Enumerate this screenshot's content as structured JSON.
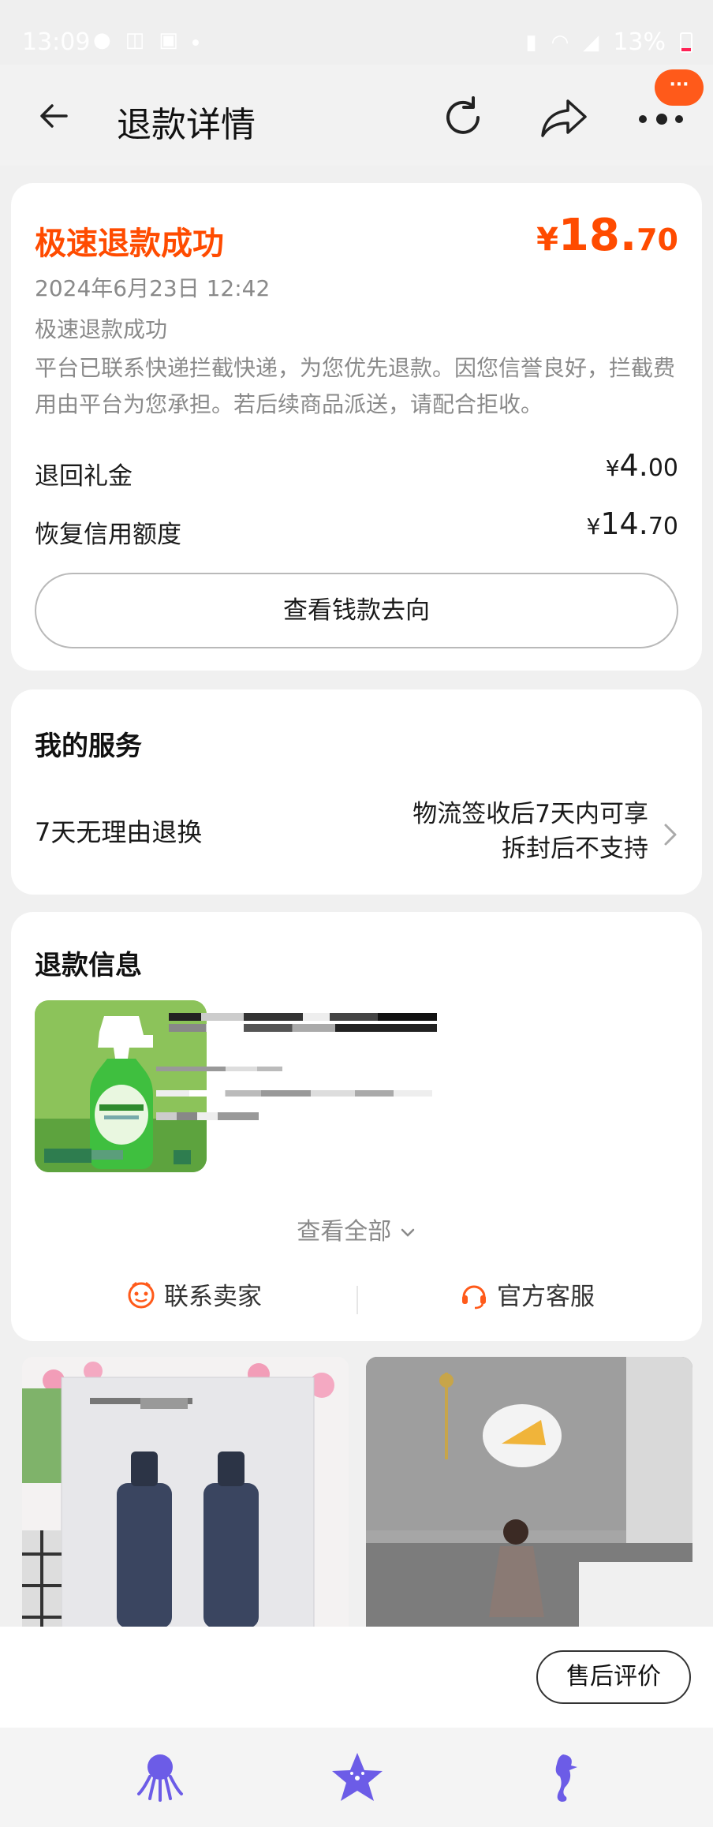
{
  "status_bar": {
    "time": "13:09",
    "battery": "13%",
    "icons_left": [
      "chat-icon",
      "notification-icon",
      "gallery-icon"
    ],
    "icons_right": [
      "sim-icon",
      "wifi-icon",
      "hd-icon",
      "signal-icon",
      "battery-icon"
    ]
  },
  "nav": {
    "title": "退款详情",
    "badge": "···",
    "icons": [
      "back-arrow-icon",
      "refresh-icon",
      "share-icon",
      "more-icon"
    ]
  },
  "refund": {
    "title": "极速退款成功",
    "amount_symbol": "¥",
    "amount_int": "18.",
    "amount_dec": "70",
    "date": "2024年6月23日 12:42",
    "status": "极速退款成功",
    "description": "平台已联系快递拦截快递，为您优先退款。因您信誉良好，拦截费用由平台为您承担。若后续商品派送，请配合拒收。",
    "rows": [
      {
        "label": "退回礼金",
        "symbol": "¥",
        "int": "4.",
        "dec": "00"
      },
      {
        "label": "恢复信用额度",
        "symbol": "¥",
        "int": "14.",
        "dec": "70"
      }
    ],
    "money_button": "查看钱款去向"
  },
  "service": {
    "title": "我的服务",
    "name": "7天无理由退换",
    "desc_line1": "物流签收后7天内可享",
    "desc_line2": "拆封后不支持"
  },
  "refund_info": {
    "title": "退款信息",
    "view_all": "查看全部",
    "contact_seller": "联系卖家",
    "customer_service": "官方客服"
  },
  "action_bar": {
    "review_button": "售后评价"
  },
  "bottom_nav": {
    "items": [
      "octopus-icon",
      "starfish-icon",
      "seahorse-icon"
    ]
  },
  "colors": {
    "accent": "#ff4b00",
    "badge": "#ff5a1a",
    "nav_icons": "#6c5ce7"
  }
}
